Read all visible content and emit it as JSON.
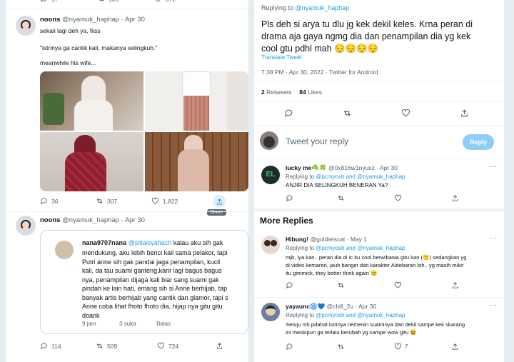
{
  "left": {
    "top_counts": {
      "c1": "17",
      "c2": "189",
      "c3": "872"
    },
    "tweet1": {
      "name": "noons",
      "handle": "@nyamuk_haphap",
      "time": "· Apr 30",
      "line1": "sekali lagi deh ya, fiiss",
      "line2": "\"istrinya ga cantik kali, makanya selingkuh.\"",
      "line3": "meanwhile his wife...",
      "replies": "36",
      "retweets": "307",
      "likes": "1,822",
      "share_tooltip": "Share"
    },
    "tweet2": {
      "name": "noons",
      "handle": "@nyamuk_haphap",
      "time": "· Apr 30",
      "quote": {
        "name": "nana9707nana",
        "mention": "@sitiaisyahach",
        "lines": [
          "kalau aku sih gak",
          "mendukung, aku lebih benci kali sama pelakor, tapi",
          "Putri anne sih gak pandai jaga penampilan, kucil",
          "kali, da tau suami ganteng,karir lagi bagus bagus",
          "nya, penampilan dijaga kali biar sang suami gak",
          "pindah ke lain hati, emang sih si Anne berhijab, tap",
          "banyak artis berhijab yang cantik dan glamor, tapi s",
          "Anne coba lihat fhoto fhoto dia, hijap nya gitu gitu",
          "doank"
        ],
        "meta_time": "9 jam",
        "meta_likes": "3 suka",
        "meta_reply": "Balas"
      },
      "replies": "114",
      "retweets": "509",
      "likes": "724"
    }
  },
  "right": {
    "replying_to_label": "Replying to",
    "replying_to_handle": "@nyamuk_haphap",
    "main_text_lines": [
      "Pls deh si arya tu dlu jg kek dekil keles. Krna peran di",
      "drama aja gaya ngmg dia dan penampilan dia yg kek",
      "cool gtu pdhl mah 😔😔😔😔"
    ],
    "translate": "Translate Tweet",
    "timestamp": "7:38 PM · Apr 30, 2022 · Twitter for Android",
    "retweets_count": "2",
    "retweets_label": "Retweets",
    "likes_count": "84",
    "likes_label": "Likes",
    "reply_placeholder": "Tweet your reply",
    "reply_button": "Reply",
    "reply1": {
      "name": "lucky me☘️🍀",
      "handle": "@0x816w1nyuxz",
      "time": "· Apr 30",
      "replying_label": "Replying to",
      "replying_handles": "@pcmyosh and @nyamuk_haphap",
      "text": "ANJIR DIA SELINGKUH BENERAN Ya?"
    },
    "more_replies": "More Replies",
    "reply2": {
      "name": "Hibung!",
      "handle": "@goldieiscat",
      "time": "· May 1",
      "replying_label": "Replying to",
      "replying_handles": "@pcmyosh and @nyamuk_haphap",
      "lines": [
        "mjb, iya kan.. peran dia di ic itu cool berwibawa gitu kan (🙂) sedangkan yg",
        "di video kemaren, jauh banget dari karakter Aldebaran loh.. yg masih mikir",
        "itu gimmick, they better think again 😊"
      ]
    },
    "reply3": {
      "name": "yayaunc🌀💙",
      "handle": "@chill_2u",
      "time": "· Apr 30",
      "replying_label": "Replying to",
      "replying_handles": "@pcmyosh and @nyamuk_haphap",
      "lines": [
        "Setuju nih pdahal istrinya nemenin suaminya dari dekil sampe kek skarang",
        "ini meskipun ga terlalu berubah yg sampe wow gitu 😆"
      ],
      "likes": "7"
    }
  },
  "colors": {
    "accent": "#1d9bf0",
    "text": "#0f1419",
    "muted": "#536471"
  }
}
